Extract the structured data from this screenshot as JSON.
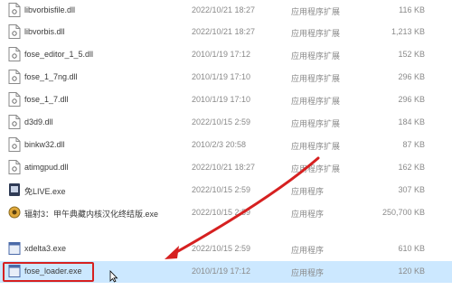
{
  "files": [
    {
      "name": "libvorbisfile.dll",
      "date": "2022/10/21 18:27",
      "type": "应用程序扩展",
      "size": "116 KB",
      "icon": "dll-file-icon"
    },
    {
      "name": "libvorbis.dll",
      "date": "2022/10/21 18:27",
      "type": "应用程序扩展",
      "size": "1,213 KB",
      "icon": "dll-file-icon"
    },
    {
      "name": "fose_editor_1_5.dll",
      "date": "2010/1/19 17:12",
      "type": "应用程序扩展",
      "size": "152 KB",
      "icon": "dll-file-icon"
    },
    {
      "name": "fose_1_7ng.dll",
      "date": "2010/1/19 17:10",
      "type": "应用程序扩展",
      "size": "296 KB",
      "icon": "dll-file-icon"
    },
    {
      "name": "fose_1_7.dll",
      "date": "2010/1/19 17:10",
      "type": "应用程序扩展",
      "size": "296 KB",
      "icon": "dll-file-icon"
    },
    {
      "name": "d3d9.dll",
      "date": "2022/10/15 2:59",
      "type": "应用程序扩展",
      "size": "184 KB",
      "icon": "dll-file-icon"
    },
    {
      "name": "binkw32.dll",
      "date": "2010/2/3 20:58",
      "type": "应用程序扩展",
      "size": "87 KB",
      "icon": "dll-file-icon"
    },
    {
      "name": "atimgpud.dll",
      "date": "2022/10/21 18:27",
      "type": "应用程序扩展",
      "size": "162 KB",
      "icon": "dll-file-icon"
    },
    {
      "name": "免LIVE.exe",
      "date": "2022/10/15 2:59",
      "type": "应用程序",
      "size": "307 KB",
      "icon": "app-exe-icon"
    },
    {
      "name": "辐射3：甲午典藏内核汉化终结版.exe",
      "date": "2022/10/15 2:59",
      "type": "应用程序",
      "size": "250,700 KB",
      "icon": "game-exe-icon"
    },
    {
      "name": "xdelta3.exe",
      "date": "2022/10/15 2:59",
      "type": "应用程序",
      "size": "610 KB",
      "icon": "exe-icon"
    },
    {
      "name": "fose_loader.exe",
      "date": "2010/1/19 17:12",
      "type": "应用程序",
      "size": "120 KB",
      "icon": "exe-icon",
      "selected": true
    }
  ],
  "colors": {
    "selection": "#cce8ff",
    "highlight": "#d62020",
    "arrow": "#d62020"
  }
}
